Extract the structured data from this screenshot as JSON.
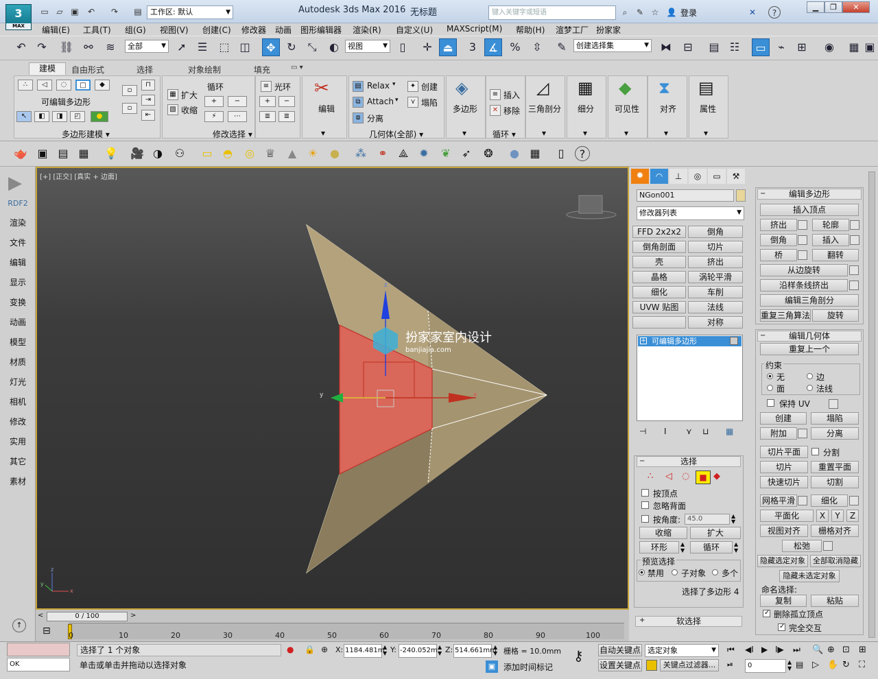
{
  "app": {
    "logo_text": "3",
    "logo_sub": "MAX",
    "workspace": "工作区: 默认",
    "title": "Autodesk 3ds Max 2016",
    "doc_title": "无标题",
    "search_placeholder": "键入关键字或短语",
    "login": "登录"
  },
  "menu": [
    "编辑(E)",
    "工具(T)",
    "组(G)",
    "视图(V)",
    "创建(C)",
    "修改器",
    "动画",
    "图形编辑器",
    "渲染(R)",
    "自定义(U)",
    "MAXScript(M)",
    "帮助(H)",
    "渲梦工厂",
    "扮家家"
  ],
  "toolbar": {
    "filter": "全部",
    "refcoord": "视图",
    "selection_set": "创建选择集"
  },
  "ribbon": {
    "tabs": [
      "建模",
      "自由形式",
      "选择",
      "对象绘制",
      "填充"
    ],
    "panel1_title": "可编辑多边形",
    "panel1_footer": "多边形建模 ▾",
    "grow": "扩大",
    "shrink": "收缩",
    "loop": "循环",
    "ring": "光环",
    "modsel_footer": "修改选择 ▾",
    "edit": "编辑",
    "relax": "Relax",
    "attach": "Attach",
    "detach": "分离",
    "create": "创建",
    "collapse": "塌陷",
    "geom_footer": "几何体(全部) ▾",
    "polygons": "多边形",
    "insert": "插入",
    "remove": "移除",
    "loops_footer": "循环 ▾",
    "tris": "三角剖分",
    "subdiv": "细分",
    "visibility": "可见性",
    "align": "对齐",
    "props": "属性"
  },
  "sidebar": [
    "RDF2",
    "渲染",
    "文件",
    "编辑",
    "显示",
    "变换",
    "动画",
    "模型",
    "材质",
    "灯光",
    "相机",
    "修改",
    "实用",
    "其它",
    "素材"
  ],
  "viewport": {
    "label": "[+] [正交] [真实 + 边面]",
    "watermark_cn": "扮家家室内设计",
    "watermark_en": "banjiajia.com",
    "axis_x": "x",
    "axis_y": "y",
    "axis_z": "z"
  },
  "cmd": {
    "object_name": "NGon001",
    "modifier_list": "修改器列表",
    "modifier_buttons": [
      [
        "FFD 2x2x2",
        "倒角"
      ],
      [
        "倒角剖面",
        "切片"
      ],
      [
        "壳",
        "挤出"
      ],
      [
        "晶格",
        "涡轮平滑"
      ],
      [
        "细化",
        "车削"
      ],
      [
        "UVW 贴图",
        "法线"
      ],
      [
        "",
        "对称"
      ]
    ],
    "stack_item": "可编辑多边形",
    "sel_title": "选择",
    "by_vertex": "按顶点",
    "ignore_back": "忽略背面",
    "by_angle": "按角度:",
    "angle_value": "45.0",
    "shrink": "收缩",
    "grow": "扩大",
    "ring": "环形",
    "loop": "循环",
    "preview_title": "预览选择",
    "preview_off": "禁用",
    "preview_sub": "子对象",
    "preview_multi": "多个",
    "sel_status": "选择了多边形 4",
    "soft_sel": "软选择"
  },
  "rollout2": {
    "edit_poly_title": "编辑多边形",
    "insert_vertex": "插入顶点",
    "extrude": "挤出",
    "outline": "轮廓",
    "bevel": "倒角",
    "inset": "插入",
    "bridge": "桥",
    "flip": "翻转",
    "hinge": "从边旋转",
    "extrude_spline": "沿样条线挤出",
    "edit_tri": "编辑三角剖分",
    "retri": "重复三角算法",
    "turn": "旋转",
    "edit_geom_title": "编辑几何体",
    "repeat_last": "重复上一个",
    "constraints": "约束",
    "c_none": "无",
    "c_edge": "边",
    "c_face": "面",
    "c_normal": "法线",
    "preserve_uv": "保持 UV",
    "create": "创建",
    "collapse": "塌陷",
    "attach": "附加",
    "detach": "分离",
    "slice_plane": "切片平面",
    "split": "分割",
    "slice": "切片",
    "reset_plane": "重置平面",
    "quickslice": "快速切片",
    "cut": "切割",
    "meshsmooth": "网格平滑",
    "tessellate": "细化",
    "make_planar": "平面化",
    "x": "X",
    "y": "Y",
    "z": "Z",
    "view_align": "视图对齐",
    "grid_align": "栅格对齐",
    "relax": "松弛",
    "hide_sel": "隐藏选定对象",
    "unhide_all": "全部取消隐藏",
    "hide_unsel": "隐藏未选定对象",
    "named_sel": "命名选择:",
    "copy": "复制",
    "paste": "粘贴",
    "delete_iso": "删除孤立顶点",
    "full_interact": "完全交互"
  },
  "timeline": {
    "frame": "0 / 100",
    "ticks": [
      "0",
      "10",
      "20",
      "30",
      "40",
      "50",
      "60",
      "70",
      "80",
      "90",
      "100"
    ]
  },
  "status": {
    "script_out": "OK",
    "msg1": "选择了 1 个对象",
    "msg2": "单击或单击并拖动以选择对象",
    "x_label": "X:",
    "x_val": "1184.481m",
    "y_label": "Y:",
    "y_val": "-240.052m",
    "z_label": "Z:",
    "z_val": "514.661mm",
    "grid": "栅格 = 10.0mm",
    "add_time_tag": "添加时间标记",
    "auto_key": "自动关键点",
    "set_key": "设置关键点",
    "sel_obj": "选定对象",
    "key_filters": "关键点过滤器...",
    "frame_field": "0"
  },
  "colors": {
    "selection_face": "#d9675a",
    "mesh_face": "#c8b583",
    "viewport_border": "#c8a63a",
    "active_blue": "#3a8fd6"
  }
}
